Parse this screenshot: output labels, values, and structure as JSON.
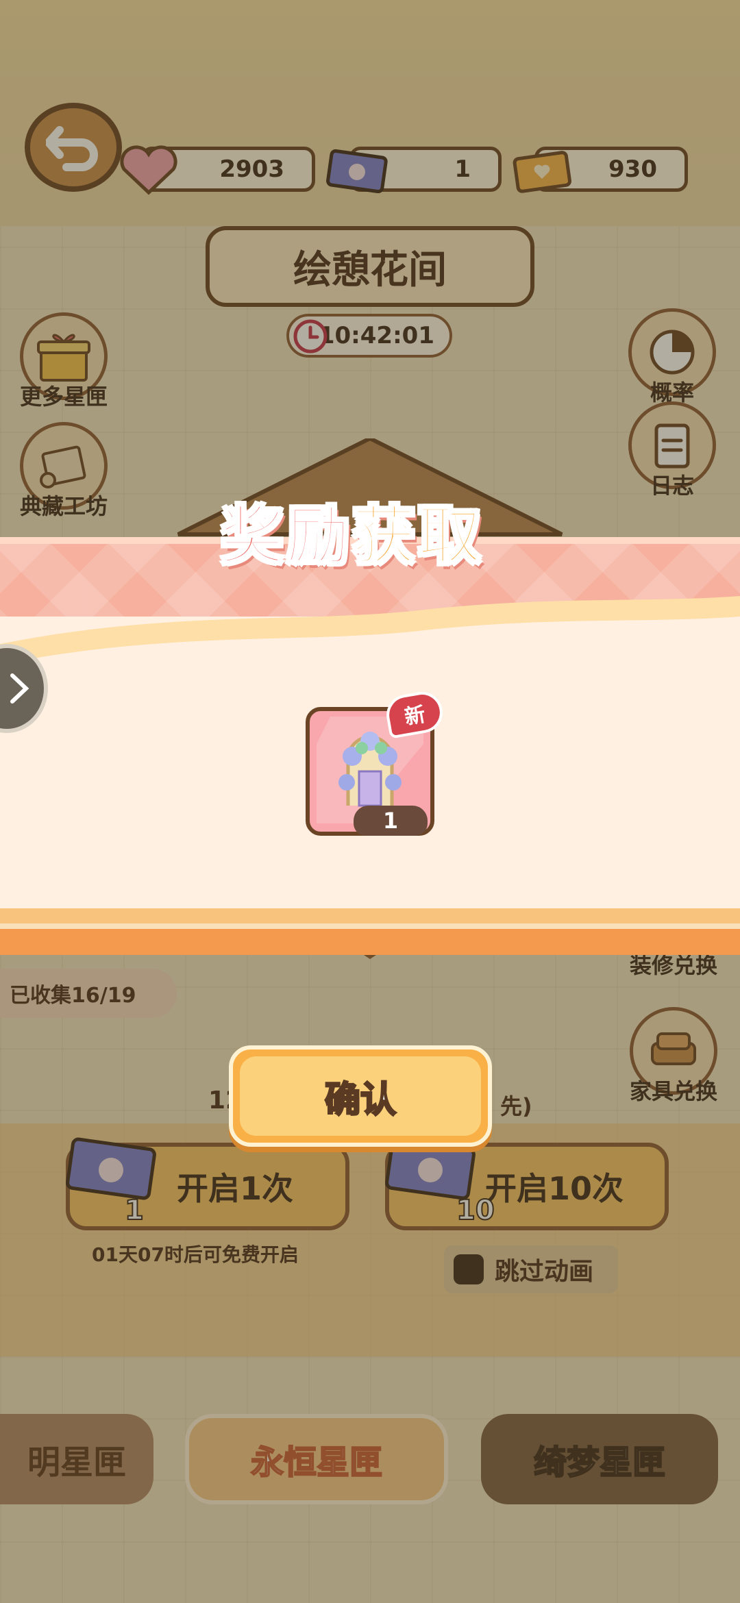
{
  "colors": {
    "accent_brown": "#6a4425",
    "banner_pink": "#f6b09d",
    "confirm_orange": "#f9b046",
    "title_red": "#ee5a56",
    "title_orange": "#f6a52f"
  },
  "top_bar": {
    "back_icon": "back-arrow-icon",
    "resources": [
      {
        "icon": "heart-ticket-icon",
        "value": "2903"
      },
      {
        "icon": "bunny-ticket-icon",
        "value": "1"
      },
      {
        "icon": "gold-ticket-icon",
        "value": "930"
      }
    ]
  },
  "banner": {
    "title": "绘憩花间",
    "countdown": "10:42:01"
  },
  "left_menu": [
    {
      "icon": "gift-box-icon",
      "label": "更多星匣"
    },
    {
      "icon": "scroll-icon",
      "label": "典藏工坊"
    }
  ],
  "right_menu": [
    {
      "icon": "pie-chart-icon",
      "label": "概率"
    },
    {
      "icon": "clipboard-icon",
      "label": "日志"
    },
    {
      "icon": "",
      "label": "装修兑换"
    },
    {
      "icon": "sofa-icon",
      "label": "家具兑换"
    }
  ],
  "collection": {
    "label": "已收集16/19"
  },
  "partial_hint": {
    "left": "12",
    "right": "先)"
  },
  "open_buttons": [
    {
      "label": "开启1次",
      "count": "1"
    },
    {
      "label": "开启10次",
      "count": "10"
    }
  ],
  "free_hint": "01天07时后可免费开启",
  "skip_animation": "跳过动画",
  "bottom_tabs": [
    {
      "label": "明星匣"
    },
    {
      "label": "永恒星匣"
    },
    {
      "label": "绮梦星匣"
    }
  ],
  "reward": {
    "title_part1": "奖励",
    "title_part2": "获取",
    "item": {
      "icon": "flower-arch-icon",
      "quantity": "1",
      "new_badge": "新"
    },
    "confirm_label": "确认"
  }
}
